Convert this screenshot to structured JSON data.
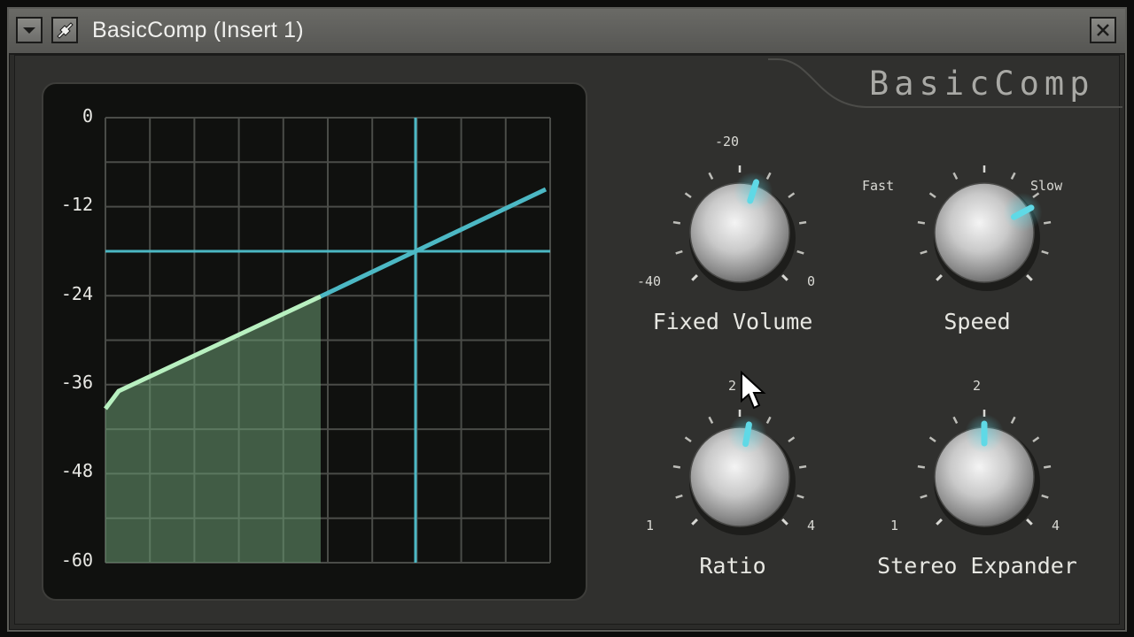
{
  "window": {
    "title": "BasicComp (Insert 1)",
    "icons": [
      "dropdown-arrow-icon",
      "plugin-icon",
      "close-icon"
    ]
  },
  "brand": "BasicComp",
  "graph": {
    "y_ticks": [
      "0",
      "-12",
      "-24",
      "-36",
      "-48",
      "-60"
    ],
    "colors": {
      "curve_active": "#b8f0c0",
      "curve": "#4cb8c4",
      "crosshair": "#4cb8c4",
      "fill": "#6a9a72"
    }
  },
  "knobs": {
    "fixed_volume": {
      "name": "Fixed Volume",
      "min_label": "-40",
      "max_label": "0",
      "top_label": "-20"
    },
    "speed": {
      "name": "Speed",
      "min_label": "Fast",
      "max_label": "Slow"
    },
    "ratio": {
      "name": "Ratio",
      "min_label": "1",
      "max_label": "4",
      "top_label": "2"
    },
    "stereo_expander": {
      "name": "Stereo Expander",
      "min_label": "1",
      "max_label": "4",
      "top_label": "2"
    }
  },
  "accent_color": "#5fd9e6"
}
